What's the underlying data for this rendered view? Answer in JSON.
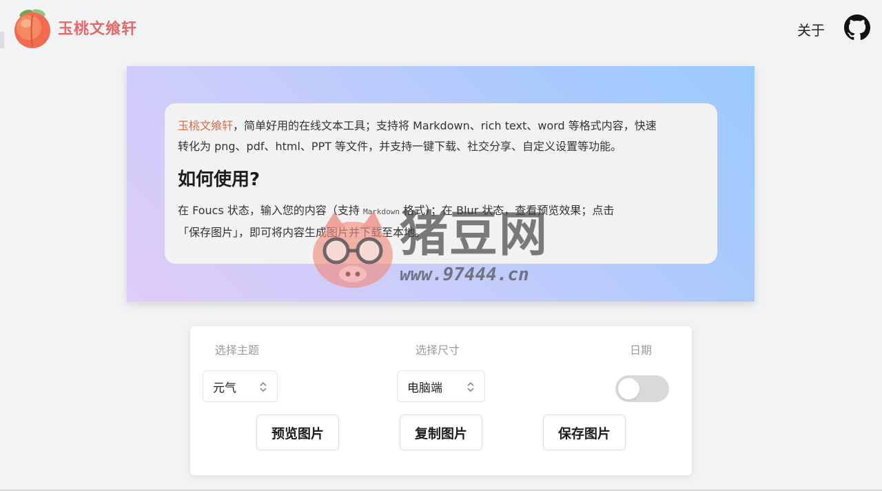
{
  "header": {
    "brand": "玉桃文飨轩",
    "about_label": "关于"
  },
  "editor": {
    "intro_brand": "玉桃文飨轩",
    "intro_rest_line1": "，简单好用的在线文本工具；支持将 Markdown、rich text、word 等格式内容，快速",
    "intro_line2": "转化为 png、pdf、html、PPT 等文件，并支持一键下载、社交分享、自定义设置等功能。",
    "heading": "如何使用?",
    "usage_part1": "在 Foucs 状态，输入您的内容（支持 ",
    "usage_code": "Markdown",
    "usage_part2": " 格式）；在 Blur 状态，查看预览效果；点击",
    "usage_line2": "「保存图片」，即可将内容生成图片并下载至本地。"
  },
  "watermark": {
    "title": "猪豆网",
    "url": "www.97444.cn"
  },
  "controls": {
    "theme_label": "选择主题",
    "theme_value": "元气",
    "size_label": "选择尺寸",
    "size_value": "电脑端",
    "date_label": "日期",
    "date_enabled": false,
    "preview_button": "预览图片",
    "copy_button": "复制图片",
    "save_button": "保存图片"
  },
  "icons": {
    "logo": "peach-icon",
    "github": "github-icon",
    "select_chevron": "chevron-up-down-icon"
  },
  "colors": {
    "brand": "#e46a6a",
    "accent": "#dc6a44",
    "gradient_start": "#e0ccf8",
    "gradient_end": "#9ccbfe"
  }
}
